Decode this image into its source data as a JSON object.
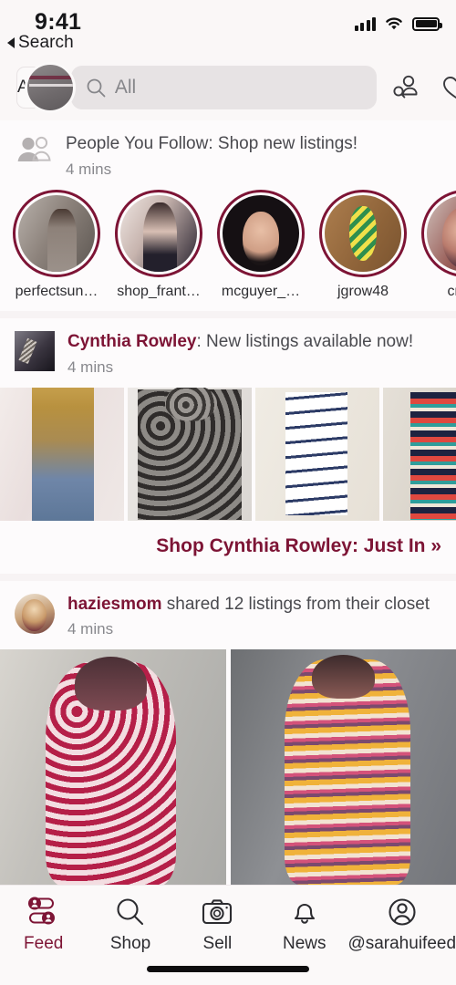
{
  "status_bar": {
    "time": "9:41",
    "back_label": "Search",
    "signal_icon": "cellular-signal-icon",
    "wifi_icon": "wifi-icon",
    "battery_icon": "battery-full-icon"
  },
  "header": {
    "filter_label": "ALL",
    "avatar_icon": "user-avatar",
    "search": {
      "placeholder": "All",
      "value": "",
      "icon": "search-icon"
    },
    "find_people_icon": "find-people-icon",
    "likes_icon": "heart-icon"
  },
  "feed": {
    "people_you_follow": {
      "icon": "people-group-icon",
      "title": "People You Follow: Shop new listings!",
      "time": "4 mins",
      "stories": [
        {
          "name": "perfectsun…",
          "art": "p-perfectsun"
        },
        {
          "name": "shop_frant…",
          "art": "p-shopfrant"
        },
        {
          "name": "mcguyer_…",
          "art": "p-mcguyer"
        },
        {
          "name": "jgrow48",
          "art": "p-jgrow"
        },
        {
          "name": "cmun",
          "art": "p-cmun"
        }
      ]
    },
    "brand_post": {
      "thumb_art": "p-cr-thumb",
      "brand": "Cynthia Rowley",
      "title_rest": ": New listings available now!",
      "time": "4 mins",
      "photos": [
        {
          "art": "p-cr1",
          "alt": "gold sequin tee"
        },
        {
          "art": "p-cr2",
          "alt": "leopard cowl neck sweater"
        },
        {
          "art": "p-cr3",
          "alt": "blue tie dye blouse"
        },
        {
          "art": "p-cr4",
          "alt": "striped knit top"
        }
      ],
      "shop_link": "Shop Cynthia Rowley: Just In »"
    },
    "user_post": {
      "avatar_art": "p-hazie",
      "username": "haziesmom",
      "action": " shared 12 listings from their closet",
      "time": "4 mins",
      "photos": [
        {
          "art": "p-big1",
          "alt": "pink floral blouse on dress form"
        },
        {
          "art": "p-big2",
          "alt": "orange ikat print tunic on dress form"
        }
      ],
      "photos_next_row": [
        {
          "art": "p-big1b",
          "alt": "listing photo partially visible"
        },
        {
          "art": "p-big2b",
          "alt": "listing photo partially visible"
        }
      ]
    }
  },
  "tabbar": {
    "items": [
      {
        "label": "Feed",
        "icon": "feed-icon",
        "active": true
      },
      {
        "label": "Shop",
        "icon": "search-icon",
        "active": false
      },
      {
        "label": "Sell",
        "icon": "camera-icon",
        "active": false
      },
      {
        "label": "News",
        "icon": "bell-icon",
        "active": false
      },
      {
        "label": "@sarahuifeed",
        "icon": "account-icon",
        "active": false
      }
    ]
  },
  "colors": {
    "brand_maroon": "#7d1435",
    "page_background": "#f7f3f4",
    "card_background": "#fdfbfc",
    "search_field": "#e7e3e4",
    "text_primary": "#2c2c30",
    "text_secondary": "#88888d"
  }
}
